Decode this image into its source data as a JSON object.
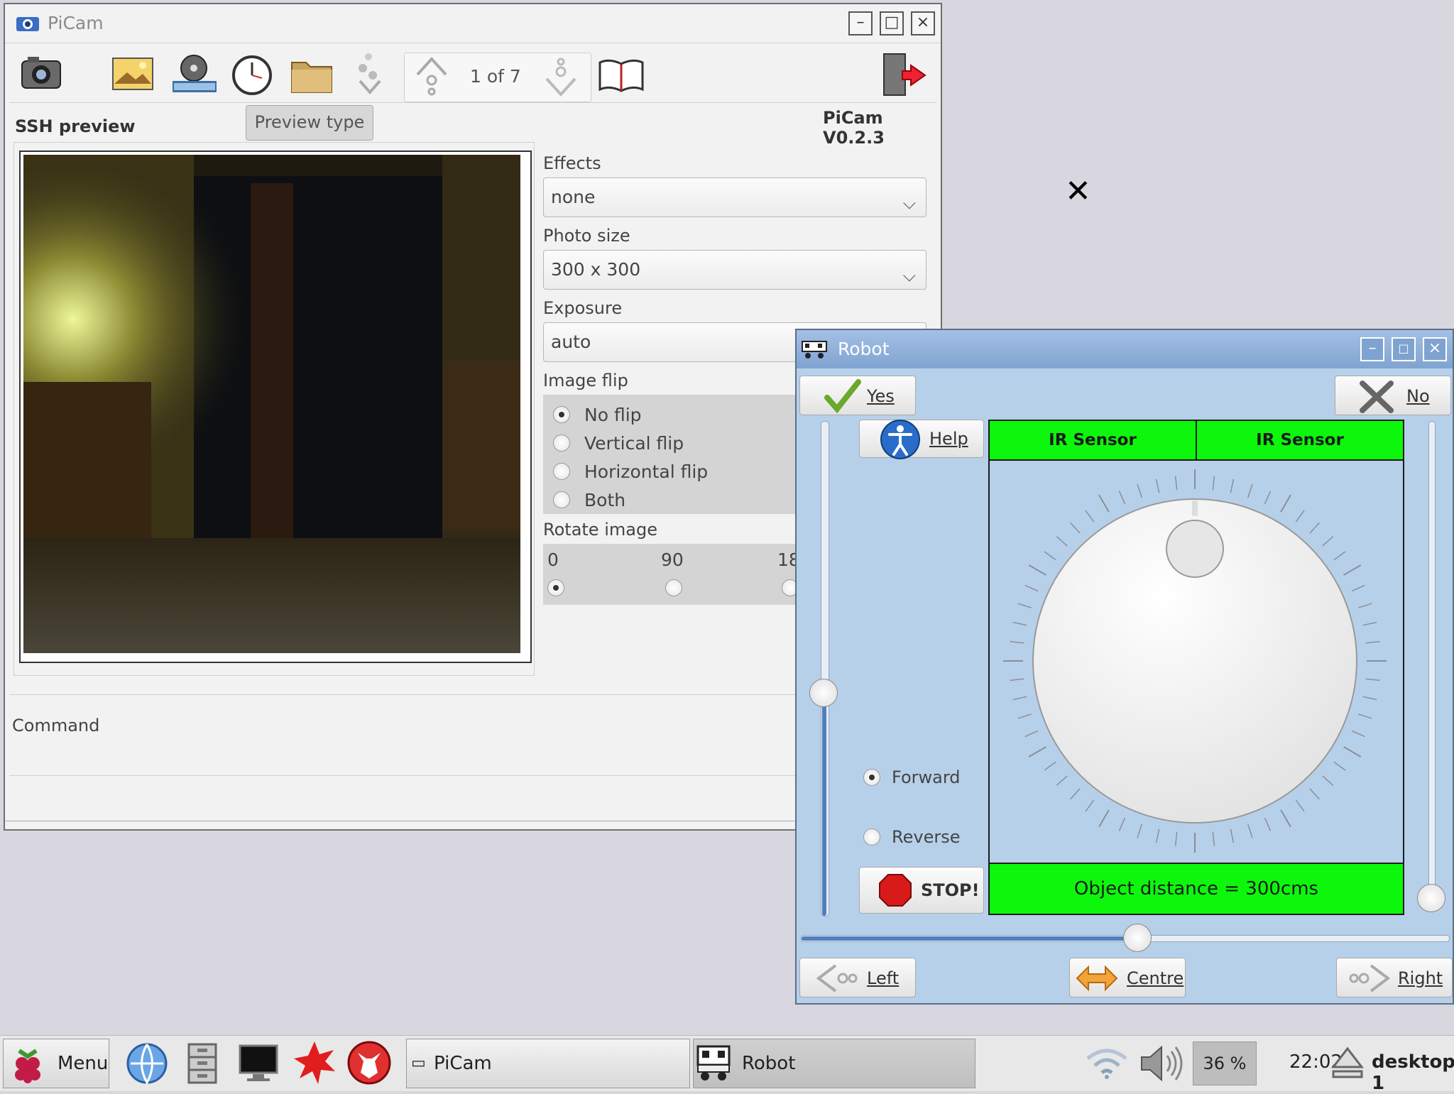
{
  "picam": {
    "title": "PiCam",
    "page_counter": "1 of 7",
    "ssh_preview_label": "SSH preview",
    "preview_type_label": "Preview type",
    "version": "PiCam V0.2.3",
    "effects": {
      "label": "Effects",
      "value": "none"
    },
    "photo_size": {
      "label": "Photo size",
      "value": "300 x 300"
    },
    "exposure": {
      "label": "Exposure",
      "value": "auto"
    },
    "image_flip": {
      "label": "Image flip",
      "options": [
        "No flip",
        "Vertical flip",
        "Horizontal flip",
        "Both"
      ],
      "selected": "No flip"
    },
    "rotate_image": {
      "label": "Rotate image",
      "options": [
        "0",
        "90",
        "18"
      ],
      "selected": "0"
    },
    "command_label": "Command"
  },
  "robot": {
    "title": "Robot",
    "yes_label": "Yes",
    "no_label": "No",
    "help_label": "Help",
    "ir_left": "IR Sensor",
    "ir_right": "IR Sensor",
    "forward_label": "Forward",
    "reverse_label": "Reverse",
    "stop_label": "STOP!",
    "distance_text": "Object distance = 300cms",
    "left_label": "Left",
    "centre_label": "Centre",
    "right_label": "Right",
    "direction_selected": "Forward",
    "left_slider_level": 0.55,
    "horizontal_slider_level": 0.52
  },
  "taskbar": {
    "menu_label": "Menu",
    "tasks": [
      "PiCam",
      "Robot"
    ],
    "cpu": "36 %",
    "clock": "22:02",
    "desktop": "desktop 1"
  },
  "colors": {
    "sensor_green": "#0cf70c",
    "robot_bg": "#b7d0ea",
    "titlebar_blue": "#8eaed6"
  },
  "icons": [
    "camera-icon",
    "image-icon",
    "film-reel-icon",
    "clock-icon",
    "folder-icon",
    "arrows-icon",
    "up-arrow-icon",
    "down-arrow-icon",
    "book-icon",
    "exit-icon",
    "checkmark-icon",
    "x-icon",
    "accessibility-icon",
    "stop-sign-icon",
    "left-arrow-icon",
    "centre-arrows-icon",
    "right-arrow-icon",
    "raspberry-icon",
    "globe-icon",
    "file-cabinet-icon",
    "terminal-icon",
    "burst-icon",
    "wolf-icon",
    "wifi-icon",
    "speaker-icon",
    "eject-icon"
  ]
}
